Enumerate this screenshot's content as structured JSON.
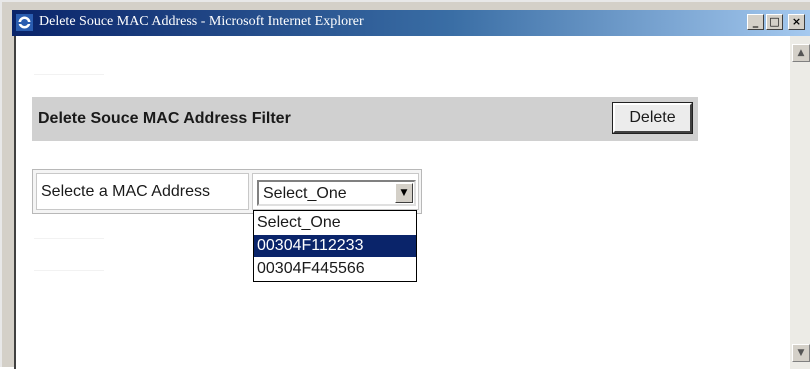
{
  "window": {
    "title": "Delete Souce MAC Address - Microsoft Internet Explorer",
    "minimize_label": "_",
    "maximize_label": "□",
    "close_label": "×"
  },
  "filter_section": {
    "title": "Delete Souce MAC Address Filter",
    "delete_label": "Delete"
  },
  "mac_select": {
    "label": "Selecte a MAC Address",
    "selected_value": "Select_One",
    "options": [
      "Select_One",
      "00304F112233",
      "00304F445566"
    ],
    "highlighted_option": "00304F112233"
  },
  "colors": {
    "titlebar_start": "#0a246a",
    "titlebar_end": "#a6caf0",
    "filter_bar": "#d0d0d0",
    "highlight": "#0a246a"
  },
  "icons": {
    "window_icon": "internet-explorer-icon",
    "dropdown_arrow": "chevron-down-icon",
    "scroll_up": "scroll-up-arrow-icon",
    "scroll_down": "scroll-down-arrow-icon"
  }
}
